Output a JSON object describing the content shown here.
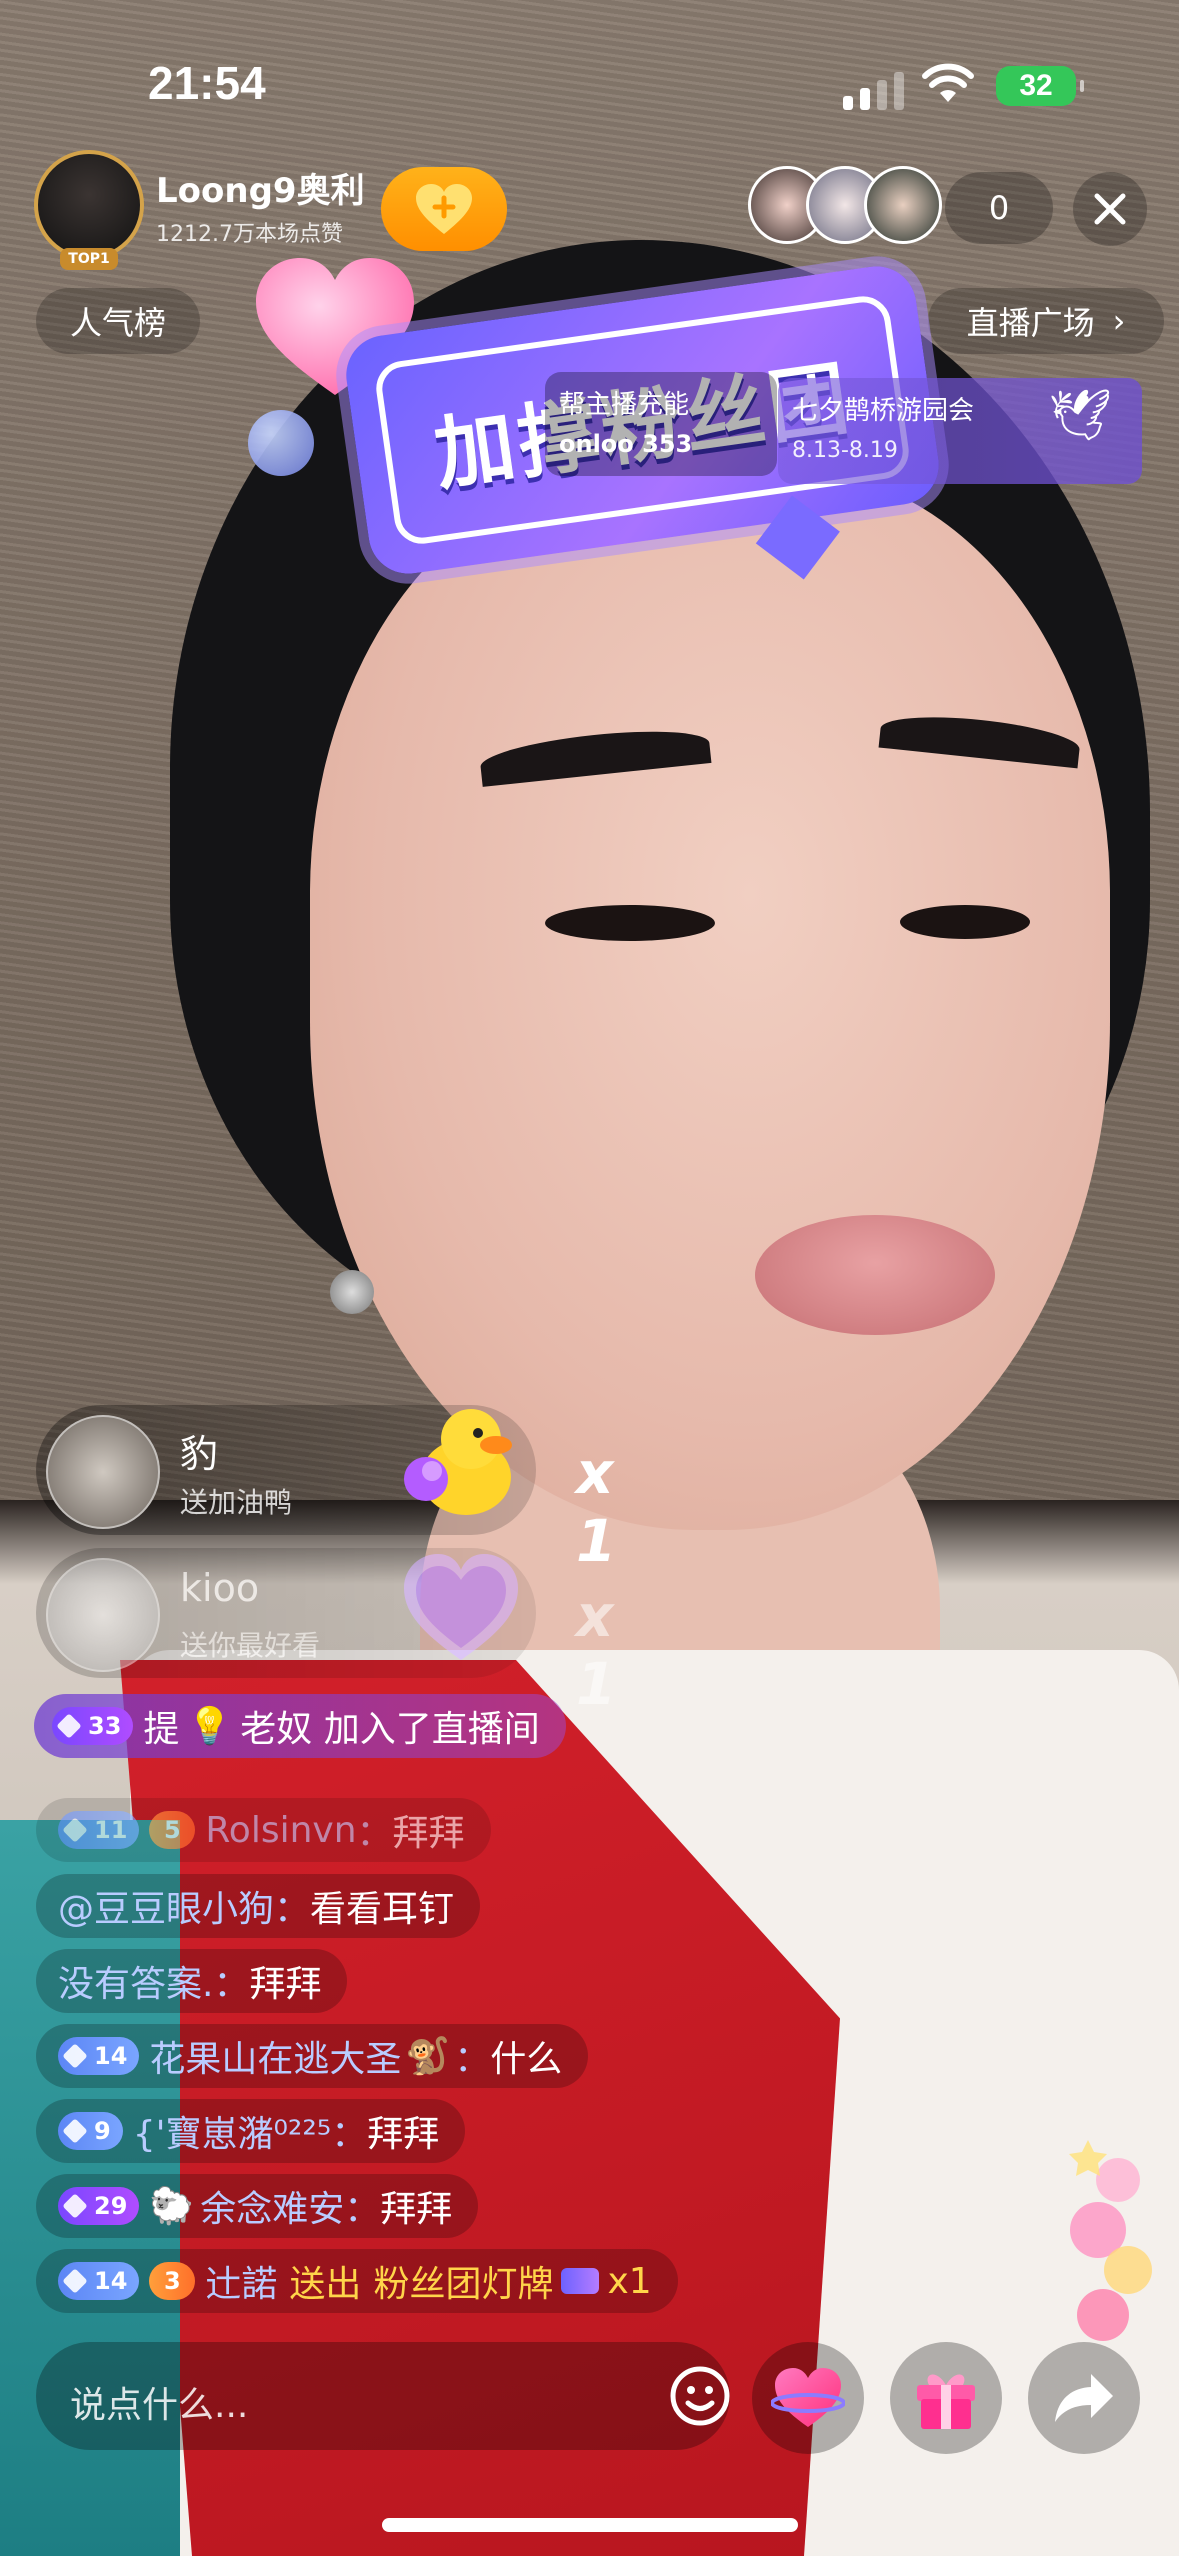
{
  "status": {
    "time": "21:54",
    "battery": "32"
  },
  "host": {
    "name": "Loong9奥利",
    "likes": "1212.7万本场点赞",
    "rank_badge": "TOP1"
  },
  "viewers": {
    "count": "0"
  },
  "top_buttons": {
    "rank": "人气榜",
    "plaza": "直播广场",
    "chevron": "›"
  },
  "fan_banner": {
    "text": "加撑粉丝团"
  },
  "helper_card": {
    "title": "帮主播充能",
    "sub": "onloo 353"
  },
  "event_card": {
    "title": "七夕鹊桥游园会",
    "date": "8.13-8.19"
  },
  "gifts": [
    {
      "user": "豹",
      "desc": "送加油鸭",
      "count": "x 1"
    },
    {
      "user": "kioo",
      "desc": "送你最好看",
      "count": "x 1"
    }
  ],
  "chat": {
    "join": {
      "level": "33",
      "user": "提",
      "message": "老奴 加入了直播间"
    },
    "lines": [
      {
        "level": "11",
        "fan": "5",
        "user": "Rolsinvn",
        "message": "拜拜"
      },
      {
        "user": "@豆豆眼小狗",
        "message": "看看耳钉"
      },
      {
        "user": "没有答案.",
        "message": "拜拜"
      },
      {
        "level": "14",
        "user": "花果山在逃大圣",
        "message": "什么"
      },
      {
        "level": "9",
        "user": "{'寶崽潴⁰²²⁵",
        "message": "拜拜"
      },
      {
        "level": "29",
        "user": "余念难安",
        "message": "拜拜"
      },
      {
        "level": "14",
        "fan": "3",
        "user": "辻諾",
        "action": "送出",
        "gift": "粉丝团灯牌",
        "count": "x1"
      }
    ],
    "separator": "："
  },
  "input": {
    "placeholder": "说点什么..."
  },
  "colors": {
    "accent": "#ff8f00",
    "chat_user": "#b9ccff",
    "gift_gold": "#ffd54a"
  }
}
